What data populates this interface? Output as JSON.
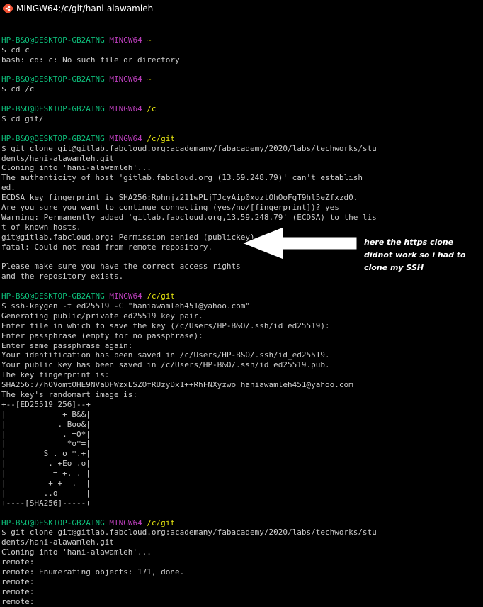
{
  "window": {
    "title": "MINGW64:/c/git/hani-alawamleh"
  },
  "icons": {
    "app": "git-bash-icon"
  },
  "colors": {
    "prompt_user": "#0dbc79",
    "prompt_env": "#bc3fbc",
    "prompt_path": "#e5e510",
    "text": "#cccccc",
    "background": "#000000"
  },
  "annotation": {
    "text": "here the https clone didnot work so i had to clone my SSH"
  },
  "terminal": {
    "lines": [
      {
        "t": "blank"
      },
      {
        "t": "prompt",
        "user": "HP-B&O@DESKTOP-GB2ATNG",
        "env": "MINGW64",
        "path": "~"
      },
      {
        "t": "text",
        "text": "$ cd c"
      },
      {
        "t": "text",
        "text": "bash: cd: c: No such file or directory"
      },
      {
        "t": "blank"
      },
      {
        "t": "prompt",
        "user": "HP-B&O@DESKTOP-GB2ATNG",
        "env": "MINGW64",
        "path": "~"
      },
      {
        "t": "text",
        "text": "$ cd /c"
      },
      {
        "t": "blank"
      },
      {
        "t": "prompt",
        "user": "HP-B&O@DESKTOP-GB2ATNG",
        "env": "MINGW64",
        "path": "/c"
      },
      {
        "t": "text",
        "text": "$ cd git/"
      },
      {
        "t": "blank"
      },
      {
        "t": "prompt",
        "user": "HP-B&O@DESKTOP-GB2ATNG",
        "env": "MINGW64",
        "path": "/c/git"
      },
      {
        "t": "text",
        "text": "$ git clone git@gitlab.fabcloud.org:academany/fabacademy/2020/labs/techworks/stu"
      },
      {
        "t": "text",
        "text": "dents/hani-alawamleh.git"
      },
      {
        "t": "text",
        "text": "Cloning into 'hani-alawamleh'..."
      },
      {
        "t": "text",
        "text": "The authenticity of host 'gitlab.fabcloud.org (13.59.248.79)' can't establish"
      },
      {
        "t": "text",
        "text": "ed."
      },
      {
        "t": "text",
        "text": "ECDSA key fingerprint is SHA256:Rphnjz211wPLjTJcyAip0xoztOhOoFgT9hl5eZfxzd0."
      },
      {
        "t": "text",
        "text": "Are you sure you want to continue connecting (yes/no/[fingerprint])? yes"
      },
      {
        "t": "text",
        "text": "Warning: Permanently added 'gitlab.fabcloud.org,13.59.248.79' (ECDSA) to the lis"
      },
      {
        "t": "text",
        "text": "t of known hosts."
      },
      {
        "t": "text",
        "text": "git@gitlab.fabcloud.org: Permission denied (publickey)."
      },
      {
        "t": "text",
        "text": "fatal: Could not read from remote repository."
      },
      {
        "t": "blank"
      },
      {
        "t": "text",
        "text": "Please make sure you have the correct access rights"
      },
      {
        "t": "text",
        "text": "and the repository exists."
      },
      {
        "t": "blank"
      },
      {
        "t": "prompt",
        "user": "HP-B&O@DESKTOP-GB2ATNG",
        "env": "MINGW64",
        "path": "/c/git"
      },
      {
        "t": "text",
        "text": "$ ssh-keygen -t ed25519 -C \"haniawamleh451@yahoo.com\""
      },
      {
        "t": "text",
        "text": "Generating public/private ed25519 key pair."
      },
      {
        "t": "text",
        "text": "Enter file in which to save the key (/c/Users/HP-B&O/.ssh/id_ed25519):"
      },
      {
        "t": "text",
        "text": "Enter passphrase (empty for no passphrase):"
      },
      {
        "t": "text",
        "text": "Enter same passphrase again:"
      },
      {
        "t": "text",
        "text": "Your identification has been saved in /c/Users/HP-B&O/.ssh/id_ed25519."
      },
      {
        "t": "text",
        "text": "Your public key has been saved in /c/Users/HP-B&O/.ssh/id_ed25519.pub."
      },
      {
        "t": "text",
        "text": "The key fingerprint is:"
      },
      {
        "t": "text",
        "text": "SHA256:7/hOVomtOHE9NVaDFWzxLSZOfRUzyDx1++RhFNXyzwo haniawamleh451@yahoo.com"
      },
      {
        "t": "text",
        "text": "The key's randomart image is:"
      },
      {
        "t": "text",
        "text": "+--[ED25519 256]--+"
      },
      {
        "t": "text",
        "text": "|            + B&&|"
      },
      {
        "t": "text",
        "text": "|           . Boo&|"
      },
      {
        "t": "text",
        "text": "|            . =O*|"
      },
      {
        "t": "text",
        "text": "|             *o*=|"
      },
      {
        "t": "text",
        "text": "|        S . o *.+|"
      },
      {
        "t": "text",
        "text": "|         . +Eo .o|"
      },
      {
        "t": "text",
        "text": "|          = +. . |"
      },
      {
        "t": "text",
        "text": "|         + +  .  |"
      },
      {
        "t": "text",
        "text": "|        ..o      |"
      },
      {
        "t": "text",
        "text": "+----[SHA256]-----+"
      },
      {
        "t": "blank"
      },
      {
        "t": "prompt",
        "user": "HP-B&O@DESKTOP-GB2ATNG",
        "env": "MINGW64",
        "path": "/c/git"
      },
      {
        "t": "text",
        "text": "$ git clone git@gitlab.fabcloud.org:academany/fabacademy/2020/labs/techworks/stu"
      },
      {
        "t": "text",
        "text": "dents/hani-alawamleh.git"
      },
      {
        "t": "text",
        "text": "Cloning into 'hani-alawamleh'..."
      },
      {
        "t": "text",
        "text": "remote:"
      },
      {
        "t": "text",
        "text": "remote: Enumerating objects: 171, done."
      },
      {
        "t": "text",
        "text": "remote:"
      },
      {
        "t": "text",
        "text": "remote:"
      },
      {
        "t": "text",
        "text": "remote:"
      }
    ]
  }
}
